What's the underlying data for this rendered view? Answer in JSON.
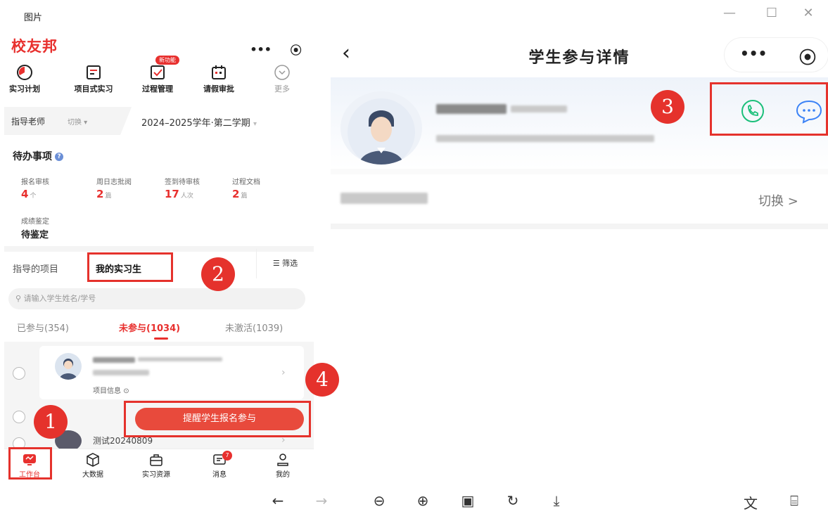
{
  "window": {
    "title": "图片",
    "minimize_icon": "—",
    "maximize_icon": "☐",
    "close_icon": "✕"
  },
  "left": {
    "brand": "校友邦",
    "capsule": {
      "more": "•••",
      "record": "⦿"
    },
    "menu": [
      {
        "label": "实习计划",
        "icon": "clock-icon"
      },
      {
        "label": "项目式实习",
        "icon": "clipboard-icon"
      },
      {
        "label": "过程管理",
        "icon": "checkbox-icon",
        "badge": "新功能"
      },
      {
        "label": "请假审批",
        "icon": "calendar-icon"
      },
      {
        "label": "更多",
        "icon": "chevron-circle-icon"
      }
    ],
    "filter": {
      "teacher": "指导老师",
      "switch": "切换",
      "term": "2024–2025学年·第二学期"
    },
    "todo": {
      "title": "待办事项",
      "help": "?",
      "stats": [
        {
          "label": "报名审核",
          "value": "4",
          "unit": "个"
        },
        {
          "label": "周日志批阅",
          "value": "2",
          "unit": "篇"
        },
        {
          "label": "签到待审核",
          "value": "17",
          "unit": "人次"
        },
        {
          "label": "过程文档",
          "value": "2",
          "unit": "篇"
        }
      ],
      "evaluation": {
        "label": "成绩鉴定",
        "value": "待鉴定"
      }
    },
    "tabs": {
      "guided": "指导的项目",
      "mine": "我的实习生",
      "filter": "筛选"
    },
    "search_placeholder": "请输入学生姓名/学号",
    "segments": {
      "joined": "已参与(354)",
      "not_joined": "未参与(1034)",
      "inactive": "未激活(1039)"
    },
    "card": {
      "project_info": "项目信息"
    },
    "remind_button": "提醒学生报名参与",
    "test_name": "测试20240809",
    "tabbar": [
      {
        "label": "工作台"
      },
      {
        "label": "大数据"
      },
      {
        "label": "实习资源"
      },
      {
        "label": "消息",
        "badge": "7"
      },
      {
        "label": "我的"
      }
    ]
  },
  "right": {
    "title": "学生参与详情",
    "capsule": {
      "more": "•••",
      "record": "⦿"
    },
    "switch": "切换 >"
  },
  "callouts": [
    "1",
    "2",
    "3",
    "4"
  ],
  "colors": {
    "accent": "#e8302e",
    "callout": "#e5322c",
    "phone": "#1bbf7a",
    "chat": "#3b82f6"
  }
}
